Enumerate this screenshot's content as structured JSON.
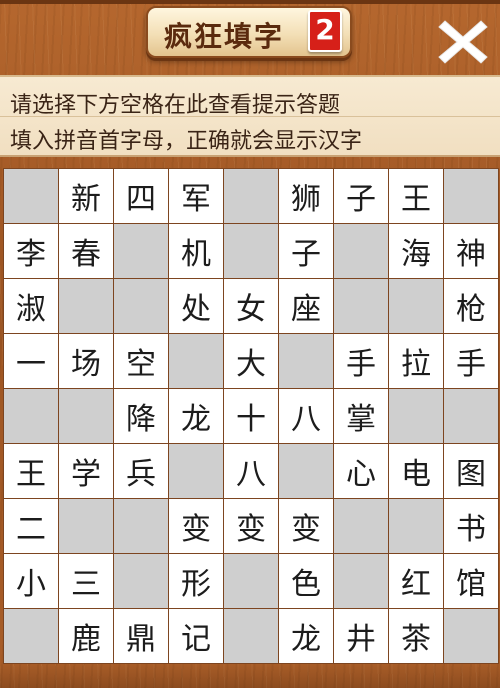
{
  "header": {
    "title": "疯狂填字",
    "level": "2",
    "close_icon": "close-icon"
  },
  "hint": {
    "line1": "请选择下方空格在此查看提示答题",
    "line2": "填入拼音首字母，正确就会显示汉字"
  },
  "colors": {
    "blank_cell": "#cfcfcf",
    "filled_cell": "#ffffff",
    "level_badge": "#d62019",
    "wood": "#a85d28"
  },
  "grid": [
    [
      "",
      "新",
      "四",
      "军",
      "",
      "狮",
      "子",
      "王",
      ""
    ],
    [
      "李",
      "春",
      "",
      "机",
      "",
      "子",
      "",
      "海",
      "神"
    ],
    [
      "淑",
      "",
      "",
      "处",
      "女",
      "座",
      "",
      "",
      "枪"
    ],
    [
      "一",
      "场",
      "空",
      "",
      "大",
      "",
      "手",
      "拉",
      "手"
    ],
    [
      "",
      "",
      "降",
      "龙",
      "十",
      "八",
      "掌",
      "",
      ""
    ],
    [
      "王",
      "学",
      "兵",
      "",
      "八",
      "",
      "心",
      "电",
      "图"
    ],
    [
      "二",
      "",
      "",
      "变",
      "变",
      "变",
      "",
      "",
      "书"
    ],
    [
      "小",
      "三",
      "",
      "形",
      "",
      "色",
      "",
      "红",
      "馆"
    ],
    [
      "",
      "鹿",
      "鼎",
      "记",
      "",
      "龙",
      "井",
      "茶",
      ""
    ]
  ]
}
